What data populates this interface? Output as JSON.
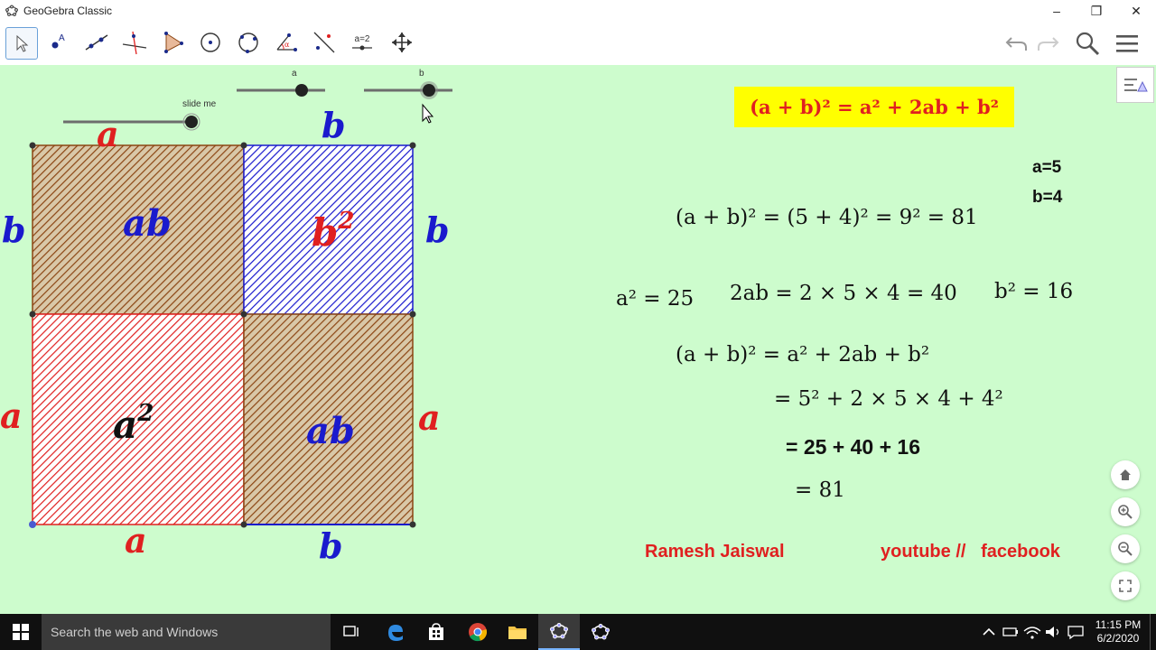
{
  "window": {
    "title": "GeoGebra Classic"
  },
  "toolbar": {
    "tools": [
      {
        "name": "move-tool",
        "label": ""
      },
      {
        "name": "point-tool",
        "label": ""
      },
      {
        "name": "line-tool",
        "label": ""
      },
      {
        "name": "perpendicular-line-tool",
        "label": ""
      },
      {
        "name": "polygon-tool",
        "label": ""
      },
      {
        "name": "circle-tool",
        "label": ""
      },
      {
        "name": "circle-three-points-tool",
        "label": ""
      },
      {
        "name": "angle-tool",
        "label": ""
      },
      {
        "name": "reflect-tool",
        "label": ""
      },
      {
        "name": "slider-tool",
        "label": "a=2"
      },
      {
        "name": "move-graphics-view-tool",
        "label": ""
      }
    ]
  },
  "sliders": {
    "slide_me_label": "slide me",
    "a_label": "a",
    "b_label": "b"
  },
  "diagram": {
    "top_a": "a",
    "top_b": "b",
    "left_b": "b",
    "left_a": "a",
    "right_b": "b",
    "right_a": "a",
    "bottom_a": "a",
    "bottom_b": "b",
    "region_ab_top": "ab",
    "region_b2": "b",
    "region_b2_exp": "2",
    "region_a2": "a",
    "region_a2_exp": "2",
    "region_ab_bottom": "ab",
    "colors": {
      "brown": "#8b4513",
      "blue": "#1a1acd",
      "red": "#e02020"
    }
  },
  "formula_box": {
    "text": "(a + b)² = a² + 2ab + b²"
  },
  "values": {
    "a_value": "a=5",
    "b_value": "b=4"
  },
  "equations": {
    "line1": "(a + b)² = (5 + 4)² = 9² = 81",
    "a_sq": "a² = 25",
    "two_ab": "2ab = 2 × 5 × 4 = 40",
    "b_sq": "b² = 16",
    "expand": "(a + b)² = a² + 2ab + b²",
    "sub": "= 5² + 2 × 5 × 4 + 4²",
    "sum": "= 25 + 40 + 16",
    "result": "= 81"
  },
  "credits": {
    "author": "Ramesh Jaiswal",
    "channels": "youtube //   facebook"
  },
  "taskbar": {
    "search_placeholder": "Search the web and Windows",
    "time": "11:15 PM",
    "date": "6/2/2020"
  }
}
